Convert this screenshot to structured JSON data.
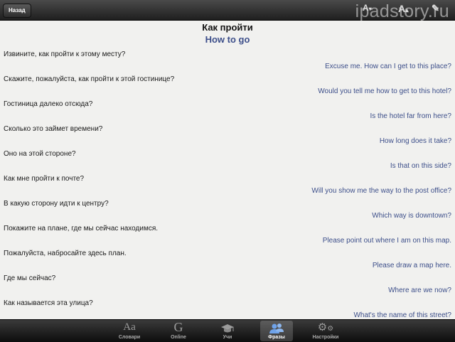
{
  "header": {
    "back_label": "Назад",
    "watermark": "ipadstory.ru"
  },
  "page": {
    "title_ru": "Как пройти",
    "title_en": "How to go"
  },
  "phrases": [
    {
      "ru": "Извините, как пройти к этому месту?",
      "en": "Excuse me. How can I get to this place?"
    },
    {
      "ru": "Скажите, пожалуйста, как пройти к этой гостинице?",
      "en": "Would you tell me how to get to this hotel?"
    },
    {
      "ru": "Гостиница далеко отсюда?",
      "en": "Is the hotel far from here?"
    },
    {
      "ru": "Сколько это займет времени?",
      "en": "How long does it take?"
    },
    {
      "ru": "Оно на этой стороне?",
      "en": "Is that on this side?"
    },
    {
      "ru": "Как мне пройти к почте?",
      "en": "Will you show me the way to the post office?"
    },
    {
      "ru": "В какую сторону идти к центру?",
      "en": "Which way is downtown?"
    },
    {
      "ru": "Покажите на плане, где мы сейчас находимся.",
      "en": "Please point out where I am on this map."
    },
    {
      "ru": "Пожалуйста, набросайте здесь план.",
      "en": "Please draw a map here."
    },
    {
      "ru": "Где мы сейчас?",
      "en": "Where are we now?"
    },
    {
      "ru": "Как называется эта улица?",
      "en": "What's the name of this street?"
    }
  ],
  "tabs": [
    {
      "label": "Словари",
      "icon": "dictionary-icon",
      "active": false
    },
    {
      "label": "Online",
      "icon": "google-icon",
      "active": false
    },
    {
      "label": "Учи",
      "icon": "graduation-cap-icon",
      "active": false
    },
    {
      "label": "Фразы",
      "icon": "people-icon",
      "active": true
    },
    {
      "label": "Настройки",
      "icon": "gears-icon",
      "active": false
    }
  ]
}
